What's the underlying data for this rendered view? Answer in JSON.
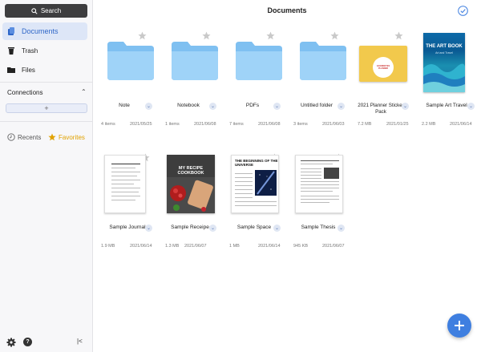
{
  "sidebar": {
    "search_label": "Search",
    "items": [
      {
        "label": "Documents",
        "icon": "documents-icon"
      },
      {
        "label": "Trash",
        "icon": "trash-icon"
      },
      {
        "label": "Files",
        "icon": "folder-icon"
      }
    ],
    "connections_label": "Connections",
    "add_label": "+",
    "recents_label": "Recents",
    "favorites_label": "Favorites",
    "help_label": "?",
    "collapse_label": "|<"
  },
  "header": {
    "title": "Documents"
  },
  "documents": [
    {
      "name": "Note",
      "meta_left": "4 items",
      "meta_right": "2021/05/25",
      "type": "folder"
    },
    {
      "name": "Notebook",
      "meta_left": "1 items",
      "meta_right": "2021/06/08",
      "type": "folder"
    },
    {
      "name": "PDFs",
      "meta_left": "7 items",
      "meta_right": "2021/06/08",
      "type": "folder"
    },
    {
      "name": "Untitled folder",
      "meta_left": "3 items",
      "meta_right": "2021/06/03",
      "type": "folder"
    },
    {
      "name": "2021 Planner Sticker Pack",
      "meta_left": "7.2 MB",
      "meta_right": "2021/01/25",
      "type": "planner",
      "cover_text": "GOODNOTES PLANNER"
    },
    {
      "name": "Sample Art Travel",
      "meta_left": "2.2 MB",
      "meta_right": "2021/06/14",
      "type": "artbook",
      "cover_title": "THE ART BOOK",
      "cover_sub": "Art and Travel"
    },
    {
      "name": "Sample Journal",
      "meta_left": "1.9 MB",
      "meta_right": "2021/06/14",
      "type": "paper"
    },
    {
      "name": "Sample Receipe",
      "meta_left": "1.3 MB",
      "meta_right": "2021/06/07",
      "type": "recipe",
      "cover_title": "MY RECIPE COOKBOOK"
    },
    {
      "name": "Sample Space",
      "meta_left": "1 MB",
      "meta_right": "2021/06/14",
      "type": "space",
      "cover_title": "THE BEGINNING OF THE UNIVERSE"
    },
    {
      "name": "Sample Thesis",
      "meta_left": "945 KB",
      "meta_right": "2021/06/07",
      "type": "thesis"
    }
  ],
  "colors": {
    "accent": "#3f7fe0",
    "folder": "#8ec9f5",
    "favorite": "#e1a200"
  }
}
